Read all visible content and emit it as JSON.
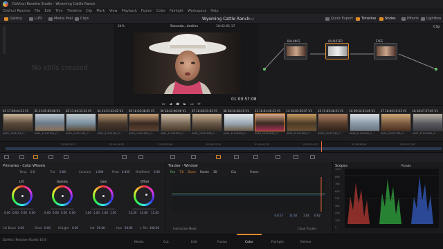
{
  "app": {
    "window_title": "DaVinci Resolve Studio - Wyoming Cattle Ranch",
    "menus": [
      "DaVinci Resolve",
      "File",
      "Edit",
      "Trim",
      "Timeline",
      "Clip",
      "Mark",
      "View",
      "Playback",
      "Fusion",
      "Color",
      "Fairlight",
      "Workspace",
      "Help"
    ],
    "version": "DaVinci Resolve Studio 16.6"
  },
  "toolbar": {
    "gallery": "Gallery",
    "luts": "LUTs",
    "media_pool": "Media Pool",
    "clips": "Clips",
    "project_title": "Wyoming Cattle Ranch",
    "edited": "Edited",
    "quick_export": "Quick Export",
    "timeline": "Timeline",
    "nodes": "Nodes",
    "effects": "Effects",
    "lightbox": "Lightbox"
  },
  "gallery": {
    "empty_text": "No stills created"
  },
  "viewer": {
    "zoom": "24%",
    "timeline_name": "Seconda...imeline",
    "timecode_top": "18:42:01:17",
    "timecode": "01:00:57:08"
  },
  "nodes": {
    "mode": "Clip",
    "items": [
      {
        "num": "01",
        "label": "BALANCE"
      },
      {
        "num": "02",
        "label": "QUALIFIER"
      },
      {
        "num": "03",
        "label": "EYES"
      }
    ]
  },
  "clips": [
    {
      "num": "01",
      "tc": "17:38:44:11",
      "track": "V1",
      "name": "A001_1101154_C..."
    },
    {
      "num": "02",
      "tc": "11:05:05:08",
      "track": "V1",
      "name": "A001_11011104_C..."
    },
    {
      "num": "03",
      "tc": "11:04:31:12",
      "track": "V1",
      "name": "A001_11011104_C..."
    },
    {
      "num": "04",
      "tc": "11:51:32:02",
      "track": "V1",
      "name": "A001_11011151_C..."
    },
    {
      "num": "05",
      "tc": "18:26:38:05",
      "track": "V1",
      "name": "A001_11011825_C..."
    },
    {
      "num": "06",
      "tc": "18:42:06:06",
      "track": "V1",
      "name": "A001_11011842_C..."
    },
    {
      "num": "07",
      "tc": "18:28:51:03",
      "track": "V1",
      "name": "A001_11011828_C..."
    },
    {
      "num": "08",
      "tc": "18:34:26:19",
      "track": "V1",
      "name": "A001_11011834_C..."
    },
    {
      "num": "13",
      "tc": "18:41:49:23",
      "track": "V1",
      "name": "A004_11011839_C..."
    },
    {
      "num": "14",
      "tc": "10:03:25:07",
      "track": "V1",
      "name": "B003_11011003_C..."
    },
    {
      "num": "15",
      "tc": "15:45:48:21",
      "track": "V1",
      "name": "A005_11011545_C..."
    },
    {
      "num": "16",
      "tc": "09:34:31:05",
      "track": "V1",
      "name": "B008_11010933_C..."
    },
    {
      "num": "17",
      "tc": "18:00:19:23",
      "track": "V1",
      "name": "A001_11011755_C..."
    },
    {
      "num": "18",
      "tc": "16:47:27:01",
      "track": "V1",
      "name": "A007_11011645_C..."
    }
  ],
  "timeline_ruler": [
    "01:00:08:13",
    "01:00:16:22",
    "01:00:25:06",
    "01:00:33:15",
    "01:00:41:23",
    "01:00:50:07",
    "01:00:58:16",
    "01:01:07:00",
    "01:01:15:09"
  ],
  "primaries": {
    "title": "Primaries - Color Wheels",
    "temp_label": "Temp",
    "temp": "0.0",
    "tint_label": "Tint",
    "tint": "0.00",
    "contrast_label": "Contrast",
    "contrast": "1.000",
    "pivot_label": "Pivot",
    "pivot": "0.435",
    "middetail_label": "Mid/Detail",
    "middetail": "0.00",
    "wheels": [
      {
        "label": "Lift",
        "values": [
          "0.00",
          "0.00",
          "0.00",
          "0.00"
        ]
      },
      {
        "label": "Gamma",
        "values": [
          "0.00",
          "0.00",
          "0.00",
          "0.00"
        ]
      },
      {
        "label": "Gain",
        "values": [
          "1.00",
          "1.00",
          "1.00",
          "1.00"
        ]
      },
      {
        "label": "Offset",
        "values": [
          "15.29",
          "14.80",
          "11.85"
        ]
      }
    ],
    "colboost_label": "Col Boost",
    "colboost": "0.00",
    "shad_label": "Shad",
    "shad": "0.00",
    "hilight_label": "Hi/Light",
    "hilight": "0.00",
    "sat_label": "Sat",
    "sat": "50.00",
    "hue_label": "Hue",
    "hue": "50.00",
    "lmix_label": "L. Mix",
    "lmix": "100.00"
  },
  "tracker": {
    "title": "Tracker - Window",
    "options": [
      "Pan",
      "Tilt",
      "Zoom",
      "Rotate",
      "3D"
    ],
    "clip_label": "Clip",
    "frame_label": "Frame",
    "readings": [
      "-10.17",
      "11.62",
      "1.01",
      "0.62"
    ],
    "interactive_mode": "Interactive Mode",
    "cloud_tracker": "Cloud Tracker"
  },
  "scopes": {
    "title": "Scopes",
    "mode": "Parade",
    "levels": [
      "1023",
      "896",
      "768",
      "640",
      "512",
      "384",
      "256",
      "128",
      "0"
    ]
  },
  "pages": [
    "Media",
    "Cut",
    "Edit",
    "Fusion",
    "Color",
    "Fairlight",
    "Deliver"
  ],
  "active_page": "Color"
}
